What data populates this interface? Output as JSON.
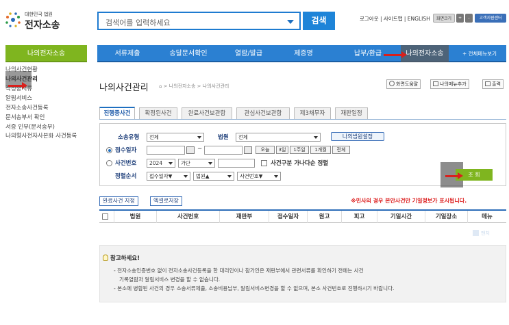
{
  "header": {
    "logo_sub": "대한민국 법원",
    "logo_main": "전자소송",
    "search_placeholder": "검색어를 입력하세요",
    "search_button": "검색",
    "util_links": "로그아웃 | 사이트맵 | ENGLISH",
    "font_size_label": "화면크기",
    "font_plus": "+",
    "font_minus": "-",
    "help_center": "고객지원센터"
  },
  "nav": {
    "items": [
      "서류제출",
      "송달문서확인",
      "열람/발급",
      "제증명",
      "납부/환급",
      "나의전자소송",
      "+ 전체메뉴보기"
    ]
  },
  "sidebar": {
    "title": "나의전자소송",
    "items": [
      "나의사건현황",
      "나의사건관리",
      "작성중서류",
      "알림서비스",
      "전자소송사건등록",
      "문서송부서 확인",
      "서증 인부(문서송부)",
      "나의형사전자사본화 사건등록"
    ]
  },
  "page": {
    "title": "나의사건관리",
    "breadcrumb": "> 나의전자소송 > 나의사건관리",
    "help_btn": "화면도움말",
    "add_menu_btn": "나의메뉴추가",
    "print_btn": "출력"
  },
  "tabs": [
    "진행중사건",
    "확정된사건",
    "완료사건보관함",
    "관심사건보관함",
    "제3채무자",
    "재판일정"
  ],
  "form": {
    "type_label": "소송유형",
    "type_value": "전체",
    "court_label": "법원",
    "court_value": "전체",
    "my_court_btn": "나의법원설정",
    "receipt_label": "접수일자",
    "date_sep": "~",
    "quick_ranges": [
      "오늘",
      "3일",
      "1주일",
      "1개월",
      "전체"
    ],
    "case_no_label": "사건번호",
    "year_value": "2024",
    "case_type_value": "가단",
    "alpha_sort_label": "사건구분 가나다순 정렬",
    "sort_label": "정렬순서",
    "sort_options": [
      "접수일자▼",
      "법원▲",
      "사건번호▼"
    ],
    "view_btn": "조 회"
  },
  "actions": {
    "complete_btn": "완료사건 지정",
    "excel_btn": "엑셀로저장",
    "notice": "※민사의 경우 본안사건만 기일정보가 표시됩니다."
  },
  "table": {
    "columns": [
      "법원",
      "사건번호",
      "재판부",
      "접수일자",
      "원고",
      "피고",
      "기일시간",
      "기일장소",
      "메뉴"
    ]
  },
  "pager_hint": "맨처",
  "info": {
    "title": "참고하세요!",
    "lines": [
      "- 전자소송인증번호 없이 전자소송사건등록을 한 대리인이나 참가인은 재판부에서 관련서류를 확인하기 전에는 사건",
      "기록열람과 알림서비스 변경을 할 수 없습니다.",
      "- 본소에 병합된 사건의 경우 소송서류제출, 소송비용납부, 알림서비스변경을 할 수 없으며, 본소 사건번호로 진행하시기 바랍니다."
    ]
  },
  "colors": {
    "nav_blue": "#2b80d2",
    "side_green": "#7fb51f",
    "arrow_red": "#d9201c"
  }
}
